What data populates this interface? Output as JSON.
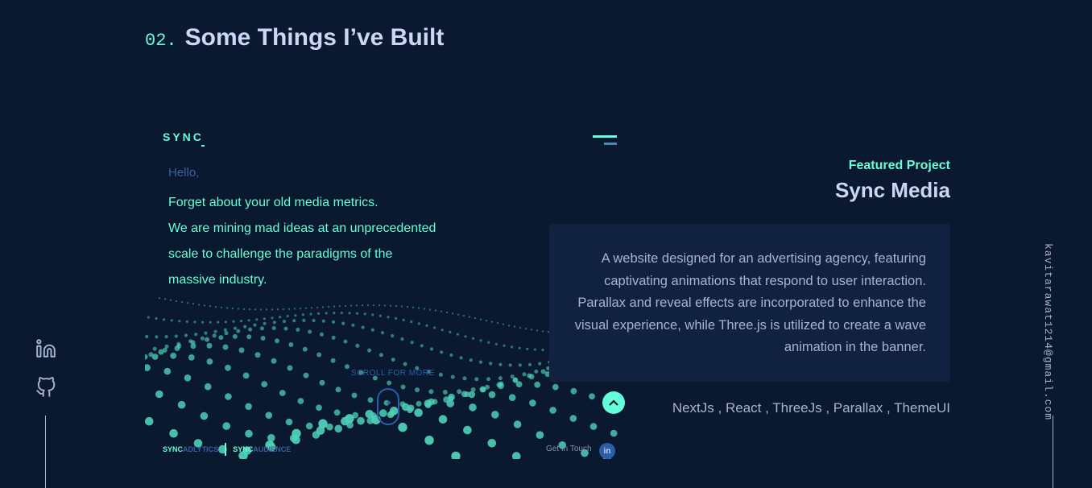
{
  "section": {
    "number": "02.",
    "title": "Some Things I’ve Built"
  },
  "project": {
    "overline": "Featured Project",
    "title": "Sync Media",
    "description": "A website designed for an advertising agency, featuring captivating animations that respond to user interaction. Parallax and reveal effects are incorporated to enhance the visual experience, while Three.js is utilized to create a wave animation in the banner.",
    "tech": "NextJs , React , ThreeJs , Parallax , ThemeUI",
    "screenshot": {
      "logo": "SYNC",
      "hello": "Hello,",
      "hero_lines": [
        "Forget about your old media metrics.",
        "We are mining mad ideas at an unprecedented",
        "scale to challenge the paradigms of the",
        "massive industry."
      ],
      "scroll_label": "SCROLL FOR MORE",
      "footer": {
        "adlytics_a": "SYNC",
        "adlytics_b": "ADLYTICS",
        "audience_a": "SYNC",
        "audience_b": "AUDIENCE",
        "get_in_touch": "Get In Touch",
        "in_badge": "in"
      },
      "up_arrow": "^"
    }
  },
  "social": {
    "linkedin_icon": "linkedin-icon",
    "github_icon": "github-icon"
  },
  "email": "kavitarawat1214@gmail.com",
  "colors": {
    "bg": "#0a192f",
    "accent": "#64ffda",
    "card": "#112240",
    "text": "#a8b2d1",
    "heading": "#ccd6f6"
  }
}
